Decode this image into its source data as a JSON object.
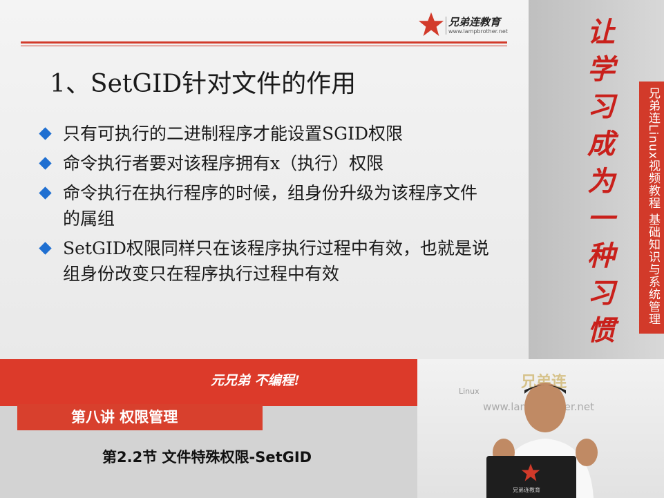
{
  "logo": {
    "brand": "兄弟连教育",
    "url": "www.lampbrother.net",
    "color": "#d23a2a"
  },
  "slide": {
    "title": "1、SetGID针对文件的作用",
    "bullets": [
      "只有可执行的二进制程序才能设置SGID权限",
      "命令执行者要对该程序拥有x（执行）权限",
      "命令执行在执行程序的时候，组身份升级为该程序文件的属组",
      "SetGID权限同样只在该程序执行过程中有效，也就是说组身份改变只在程序执行过程中有效"
    ]
  },
  "side": {
    "slogan": "让学习成为一种习惯",
    "series_title": "兄弟连Linux视频教程  基础知识与系统管理"
  },
  "banner": {
    "motto": "元兄弟 不编程!",
    "lecture": "第八讲 权限管理",
    "section": "第2.2节 文件特殊权限-SetGID"
  },
  "camera": {
    "watermark_brand": "兄弟连",
    "watermark_label": "Linux",
    "watermark_url": "www.lampbrother.net",
    "laptop_label": "兄弟连教育"
  },
  "colors": {
    "accent": "#d23a2a",
    "bullet": "#1f6fd1"
  }
}
